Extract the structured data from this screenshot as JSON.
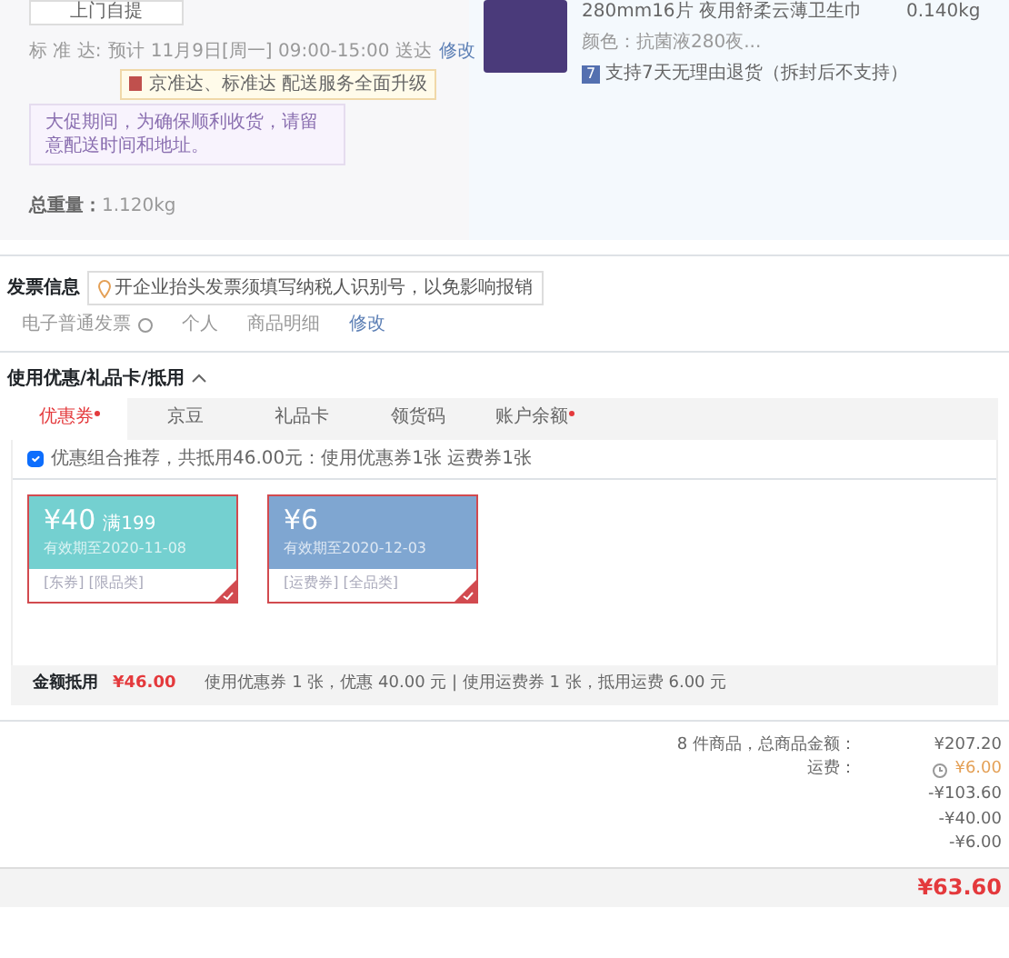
{
  "shipping": {
    "pickup_button": "上门自提",
    "delivery_label": "标 准 达:",
    "delivery_time": "预计 11月9日[周一] 09:00-15:00 送达",
    "edit_link": "修改",
    "tooltip": "京准达、标准达 配送服务全面升级",
    "notice": "大促期间，为确保顺利收货，请留意配送时间和地址。",
    "weight_label": "总重量：",
    "weight": "1.120kg"
  },
  "product": {
    "name": "280mm16片 夜用舒柔云薄卫生巾",
    "weight": "0.140kg",
    "color_text": "颜色：抗菌液280夜...",
    "return_badge": "7",
    "return_policy": "支持7天无理由退货（拆封后不支持）"
  },
  "invoice": {
    "title": "发票信息",
    "tip": "开企业抬头发票须填写纳税人识别号，以免影响报销",
    "type": "电子普通发票",
    "holder": "个人",
    "content": "商品明细",
    "edit_link": "修改"
  },
  "discounts": {
    "title": "使用优惠/礼品卡/抵用",
    "expanded": true,
    "tabs": [
      {
        "label": "优惠券",
        "selected": true,
        "dot": true
      },
      {
        "label": "京豆",
        "selected": false,
        "dot": false
      },
      {
        "label": "礼品卡",
        "selected": false,
        "dot": false
      },
      {
        "label": "领货码",
        "selected": false,
        "dot": false
      },
      {
        "label": "账户余额",
        "selected": false,
        "dot": true
      }
    ],
    "combo": {
      "checked": true,
      "label": "优惠组合推荐，共抵用46.00元：使用优惠券1张 运费券1张"
    },
    "coupons": [
      {
        "amount": "¥40",
        "condition": "满199",
        "expiry": "有效期至2020-11-08",
        "tags": "[东券]  [限品类]",
        "color": "#74d0d0",
        "selected": true
      },
      {
        "amount": "¥6",
        "expiry": "有效期至2020-12-03",
        "tags": "[运费券]  [全品类]",
        "color": "#7fa6d1",
        "selected": true
      }
    ],
    "footer": {
      "label": "金额抵用",
      "amount": "¥46.00",
      "detail": "使用优惠券 1 张，优惠 40.00 元  | 使用运费券 1 张，抵用运费 6.00 元"
    }
  },
  "summary": {
    "rows": [
      {
        "label": "8 件商品，总商品金额：",
        "value": "¥207.20",
        "kind": "plain"
      },
      {
        "label": "运费：",
        "value": "¥6.00",
        "kind": "freight"
      },
      {
        "value": "-¥103.60",
        "kind": "plain"
      },
      {
        "value": "-¥40.00",
        "kind": "plain"
      },
      {
        "value": "-¥6.00",
        "kind": "plain"
      }
    ],
    "total": "¥63.60"
  }
}
